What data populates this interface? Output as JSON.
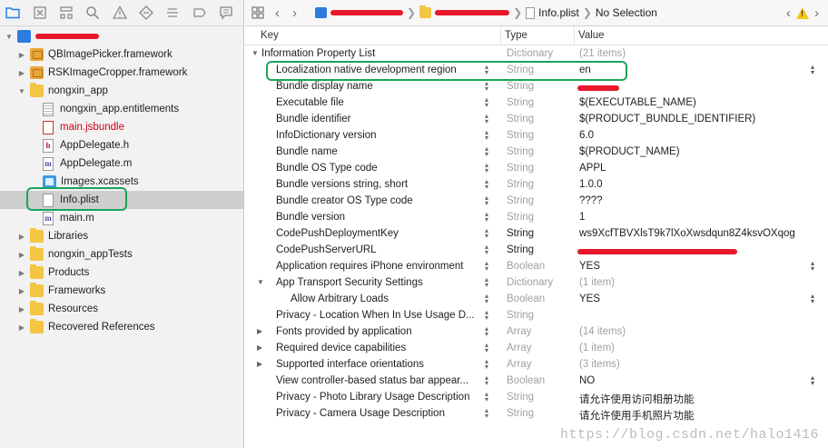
{
  "navigator": {
    "toolbar_icons": [
      "folder-icon",
      "source-control-icon",
      "hierarchy-icon",
      "search-icon",
      "issue-icon",
      "test-icon",
      "debug-icon",
      "breakpoint-icon",
      "report-icon"
    ],
    "items": [
      {
        "label": "",
        "redacted": true,
        "icon": "project-icon",
        "indent": 0,
        "disclosure": "open"
      },
      {
        "label": "QBImagePicker.framework",
        "icon": "framework-icon",
        "indent": 1,
        "disclosure": "closed"
      },
      {
        "label": "RSKImageCropper.framework",
        "icon": "framework-icon",
        "indent": 1,
        "disclosure": "closed"
      },
      {
        "label": "nongxin_app",
        "icon": "folder-icon",
        "indent": 1,
        "disclosure": "open"
      },
      {
        "label": "nongxin_app.entitlements",
        "icon": "entitlements-file-icon",
        "indent": 2,
        "disclosure": "none"
      },
      {
        "label": "main.jsbundle",
        "icon": "jsbundle-file-icon",
        "indent": 2,
        "disclosure": "none",
        "red": true
      },
      {
        "label": "AppDelegate.h",
        "icon": "header-file-icon",
        "indent": 2,
        "disclosure": "none"
      },
      {
        "label": "AppDelegate.m",
        "icon": "objc-file-icon",
        "indent": 2,
        "disclosure": "none"
      },
      {
        "label": "Images.xcassets",
        "icon": "asset-catalog-icon",
        "indent": 2,
        "disclosure": "none"
      },
      {
        "label": "Info.plist",
        "icon": "plist-file-icon",
        "indent": 2,
        "disclosure": "none",
        "selected": true
      },
      {
        "label": "main.m",
        "icon": "objc-file-icon",
        "indent": 2,
        "disclosure": "none"
      },
      {
        "label": "Libraries",
        "icon": "folder-icon",
        "indent": 1,
        "disclosure": "closed"
      },
      {
        "label": "nongxin_appTests",
        "icon": "folder-icon",
        "indent": 1,
        "disclosure": "closed"
      },
      {
        "label": "Products",
        "icon": "folder-icon",
        "indent": 1,
        "disclosure": "closed"
      },
      {
        "label": "Frameworks",
        "icon": "folder-icon",
        "indent": 1,
        "disclosure": "closed"
      },
      {
        "label": "Resources",
        "icon": "folder-icon",
        "indent": 1,
        "disclosure": "closed"
      },
      {
        "label": "Recovered References",
        "icon": "folder-icon",
        "indent": 1,
        "disclosure": "closed"
      }
    ]
  },
  "editor_bar": {
    "breadcrumb_file": "Info.plist",
    "breadcrumb_selection": "No Selection"
  },
  "table": {
    "headers": {
      "key": "Key",
      "type": "Type",
      "value": "Value"
    },
    "rows": [
      {
        "key": "Information Property List",
        "type": "Dictionary",
        "value": "(21 items)",
        "level": 0,
        "disclosure": "open",
        "gray_value": true
      },
      {
        "key": "Localization native development region",
        "type": "String",
        "value": "en",
        "level": 1,
        "value_stepper": true,
        "highlight": true
      },
      {
        "key": "Bundle display name",
        "type": "String",
        "value": "",
        "level": 1,
        "redacted_value": true
      },
      {
        "key": "Executable file",
        "type": "String",
        "value": "$(EXECUTABLE_NAME)",
        "level": 1
      },
      {
        "key": "Bundle identifier",
        "type": "String",
        "value": "$(PRODUCT_BUNDLE_IDENTIFIER)",
        "level": 1
      },
      {
        "key": "InfoDictionary version",
        "type": "String",
        "value": "6.0",
        "level": 1
      },
      {
        "key": "Bundle name",
        "type": "String",
        "value": "$(PRODUCT_NAME)",
        "level": 1
      },
      {
        "key": "Bundle OS Type code",
        "type": "String",
        "value": "APPL",
        "level": 1
      },
      {
        "key": "Bundle versions string, short",
        "type": "String",
        "value": "1.0.0",
        "level": 1
      },
      {
        "key": "Bundle creator OS Type code",
        "type": "String",
        "value": "????",
        "level": 1
      },
      {
        "key": "Bundle version",
        "type": "String",
        "value": "1",
        "level": 1
      },
      {
        "key": "CodePushDeploymentKey",
        "type": "String",
        "value": "ws9XcfTBVXlsT9k7lXoXwsdqun8Z4ksvOXqog",
        "level": 1,
        "dark_type": true
      },
      {
        "key": "CodePushServerURL",
        "type": "String",
        "value": "",
        "level": 1,
        "dark_type": true,
        "redacted_value": true
      },
      {
        "key": "Application requires iPhone environment",
        "type": "Boolean",
        "value": "YES",
        "level": 1,
        "value_stepper": true
      },
      {
        "key": "App Transport Security Settings",
        "type": "Dictionary",
        "value": "(1 item)",
        "level": 1,
        "disclosure": "open",
        "gray_value": true
      },
      {
        "key": "Allow Arbitrary Loads",
        "type": "Boolean",
        "value": "YES",
        "level": 2,
        "value_stepper": true
      },
      {
        "key": "Privacy - Location When In Use Usage D...",
        "type": "String",
        "value": "",
        "level": 1
      },
      {
        "key": "Fonts provided by application",
        "type": "Array",
        "value": "(14 items)",
        "level": 1,
        "disclosure": "closed",
        "gray_value": true
      },
      {
        "key": "Required device capabilities",
        "type": "Array",
        "value": "(1 item)",
        "level": 1,
        "disclosure": "closed",
        "gray_value": true
      },
      {
        "key": "Supported interface orientations",
        "type": "Array",
        "value": "(3 items)",
        "level": 1,
        "disclosure": "closed",
        "gray_value": true
      },
      {
        "key": "View controller-based status bar appear...",
        "type": "Boolean",
        "value": "NO",
        "level": 1,
        "value_stepper": true
      },
      {
        "key": "Privacy - Photo Library Usage Description",
        "type": "String",
        "value": "请允许使用访问相册功能",
        "level": 1
      },
      {
        "key": "Privacy - Camera Usage Description",
        "type": "String",
        "value": "请允许使用手机照片功能",
        "level": 1
      }
    ]
  },
  "watermark": "https://blog.csdn.net/halo1416",
  "colors": {
    "accent": "#1a7cf0",
    "highlight_box": "#1aa45a",
    "redaction": "#e8182b",
    "selection": "#cfcfcf"
  }
}
